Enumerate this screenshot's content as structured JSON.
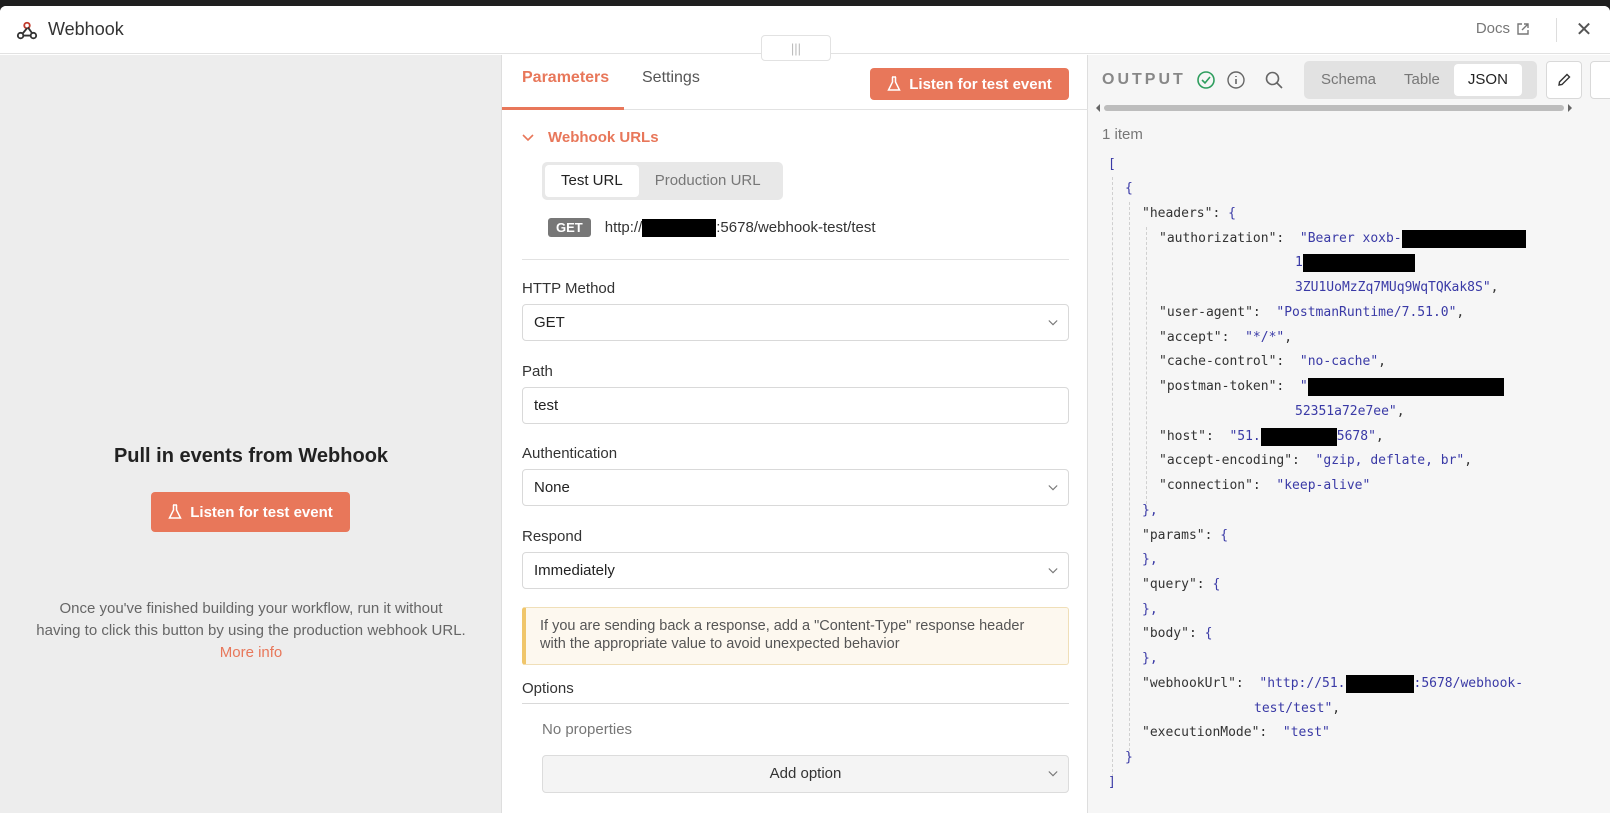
{
  "window": {
    "title": "Webhook",
    "docs_label": "Docs",
    "close_label": "✕",
    "title_icon": "webhook-icon"
  },
  "left": {
    "heading": "Pull in events from Webhook",
    "listen_label": "Listen for test event",
    "hint_text": "Once you've finished building your workflow, run it without having to click this button by using the production webhook URL.",
    "more_info": "More info"
  },
  "params": {
    "tab_parameters": "Parameters",
    "tab_settings": "Settings",
    "listen_label": "Listen for test event",
    "drag_handle": "|||",
    "section_title": "Webhook URLs",
    "url_tabs": [
      "Test URL",
      "Production URL"
    ],
    "method_badge": "GET",
    "url_prefix": "http://",
    "url_suffix": ":5678/webhook-test/test",
    "http_method_label": "HTTP Method",
    "http_method_value": "GET",
    "path_label": "Path",
    "path_value": "test",
    "auth_label": "Authentication",
    "auth_value": "None",
    "respond_label": "Respond",
    "respond_value": "Immediately",
    "notice": "If you are sending back a response, add a \"Content-Type\" response header with the appropriate value to avoid unexpected behavior",
    "options_label": "Options",
    "no_properties": "No properties",
    "add_option": "Add option"
  },
  "output": {
    "label": "OUTPUT",
    "views": [
      "Schema",
      "Table",
      "JSON"
    ],
    "active_view": "JSON",
    "items_count": "1 item",
    "json_lines": {
      "open_bracket": "[",
      "open_brace": "{",
      "headers_key": "\"headers\":",
      "headers_open": "{",
      "authorization_key": "\"authorization\":",
      "authorization_v1": "\"Bearer xoxb-",
      "authorization_v2": "1",
      "authorization_v3": "3ZU1UoMzZq7MUq9WqTQKak8S\"",
      "user_agent_key": "\"user-agent\":",
      "user_agent_val": "\"PostmanRuntime/7.51.0\"",
      "accept_key": "\"accept\":",
      "accept_val": "\"*/*\"",
      "cache_key": "\"cache-control\":",
      "cache_val": "\"no-cache\"",
      "postman_key": "\"postman-token\":",
      "postman_v1": "\"",
      "postman_v2": "52351a72e7ee\"",
      "host_key": "\"host\":",
      "host_v1": "\"51.",
      "host_v2": "5678\"",
      "encoding_key": "\"accept-encoding\":",
      "encoding_val": "\"gzip, deflate, br\"",
      "connection_key": "\"connection\":",
      "connection_val": "\"keep-alive\"",
      "close_brace_comma": "},",
      "params_key": "\"params\":",
      "query_key": "\"query\":",
      "body_key": "\"body\":",
      "webhook_key": "\"webhookUrl\":",
      "webhook_v1": "\"http://51.",
      "webhook_v2": ":5678/webhook-",
      "webhook_v3": "test/test\"",
      "mode_key": "\"executionMode\":",
      "mode_val": "\"test\"",
      "close_brace": "}",
      "close_bracket": "]",
      "comma": ",",
      "lbrace": "{"
    }
  },
  "colors": {
    "accent": "#e8775a",
    "json_string": "#3a3aa6",
    "notice_bg": "#fdf8ef"
  }
}
